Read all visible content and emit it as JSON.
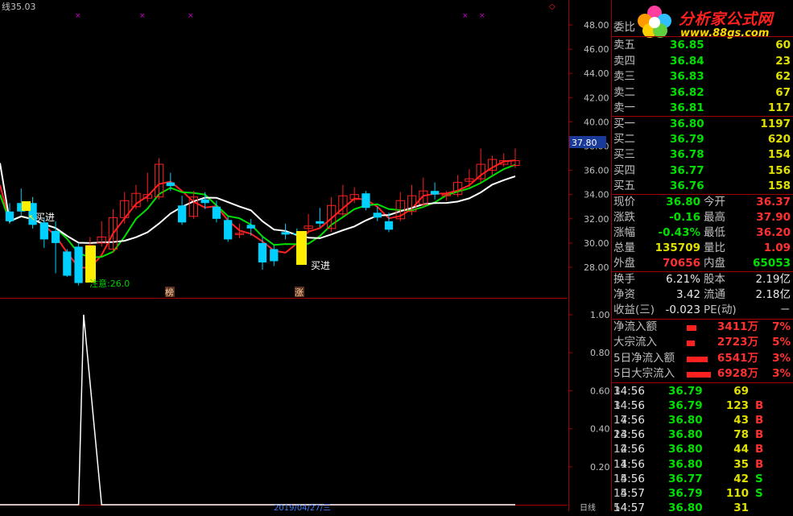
{
  "chart": {
    "title_prefix": "线",
    "title_value": "35.03",
    "y_ticks_main": [
      "48.00",
      "46.00",
      "44.00",
      "42.00",
      "40.00",
      "38.00",
      "36.00",
      "34.00",
      "32.00",
      "30.00",
      "28.00"
    ],
    "y_ticks_sub": [
      "1.00",
      "0.80",
      "0.60",
      "0.40",
      "0.20"
    ],
    "current_price_tag": "37.80",
    "annotations": {
      "buy1": "买进",
      "buy2": "买进",
      "notice": "注意:26.0",
      "badge_bang": "榜",
      "badge_zhang": "涨"
    },
    "bottom_date": "2019/04/27/三",
    "bottom_right": "日线",
    "colors": {
      "up": "#ff2020",
      "down": "#00d0ff",
      "ma_fast": "#ff2020",
      "ma_mid": "#00e000",
      "ma_slow": "#ffffff"
    }
  },
  "chart_data": {
    "type": "candlestick",
    "ylim": [
      27,
      49
    ],
    "candles": [
      {
        "o": 32.6,
        "c": 31.8,
        "h": 33.3,
        "l": 31.6
      },
      {
        "o": 33.3,
        "c": 32.6,
        "h": 34.5,
        "l": 32.3
      },
      {
        "o": 33.3,
        "c": 31.5,
        "h": 33.8,
        "l": 31.2
      },
      {
        "o": 31.7,
        "c": 30.3,
        "h": 32.1,
        "l": 29.6
      },
      {
        "o": 31.0,
        "c": 30.0,
        "h": 31.8,
        "l": 27.5
      },
      {
        "o": 29.3,
        "c": 27.3,
        "h": 29.5,
        "l": 27.2
      },
      {
        "o": 29.7,
        "c": 26.7,
        "h": 30.0,
        "l": 26.5
      },
      {
        "o": 29.2,
        "c": 29.8,
        "h": 30.5,
        "l": 28.7
      },
      {
        "o": 30.0,
        "c": 30.5,
        "h": 31.8,
        "l": 29.7
      },
      {
        "o": 29.5,
        "c": 32.1,
        "h": 32.8,
        "l": 29.2
      },
      {
        "o": 32.1,
        "c": 33.5,
        "h": 34.2,
        "l": 31.6
      },
      {
        "o": 33.0,
        "c": 34.1,
        "h": 34.8,
        "l": 32.8
      },
      {
        "o": 33.7,
        "c": 34.0,
        "h": 35.8,
        "l": 33.4
      },
      {
        "o": 33.8,
        "c": 36.5,
        "h": 37.0,
        "l": 33.6
      },
      {
        "o": 35.0,
        "c": 34.7,
        "h": 35.8,
        "l": 34.3
      },
      {
        "o": 33.1,
        "c": 31.7,
        "h": 33.9,
        "l": 31.5
      },
      {
        "o": 32.2,
        "c": 33.8,
        "h": 34.3,
        "l": 32.0
      },
      {
        "o": 33.6,
        "c": 33.3,
        "h": 34.2,
        "l": 32.8
      },
      {
        "o": 33.0,
        "c": 32.0,
        "h": 33.5,
        "l": 31.7
      },
      {
        "o": 31.9,
        "c": 30.3,
        "h": 32.2,
        "l": 30.1
      },
      {
        "o": 30.7,
        "c": 30.8,
        "h": 31.6,
        "l": 30.4
      },
      {
        "o": 31.5,
        "c": 31.2,
        "h": 32.0,
        "l": 30.6
      },
      {
        "o": 30.0,
        "c": 28.4,
        "h": 30.5,
        "l": 27.8
      },
      {
        "o": 29.5,
        "c": 28.5,
        "h": 29.8,
        "l": 28.1
      },
      {
        "o": 30.9,
        "c": 30.7,
        "h": 31.6,
        "l": 30.3
      },
      {
        "o": 30.8,
        "c": 30.7,
        "h": 31.2,
        "l": 30.4
      },
      {
        "o": 31.2,
        "c": 31.4,
        "h": 32.4,
        "l": 30.9
      },
      {
        "o": 31.8,
        "c": 31.6,
        "h": 32.9,
        "l": 31.3
      },
      {
        "o": 31.2,
        "c": 33.1,
        "h": 33.8,
        "l": 30.9
      },
      {
        "o": 32.4,
        "c": 33.9,
        "h": 34.8,
        "l": 32.2
      },
      {
        "o": 33.6,
        "c": 34.0,
        "h": 34.6,
        "l": 33.3
      },
      {
        "o": 34.1,
        "c": 32.9,
        "h": 34.3,
        "l": 32.7
      },
      {
        "o": 32.5,
        "c": 32.1,
        "h": 33.0,
        "l": 31.8
      },
      {
        "o": 31.8,
        "c": 31.1,
        "h": 32.5,
        "l": 30.9
      },
      {
        "o": 32.0,
        "c": 33.5,
        "h": 34.2,
        "l": 31.8
      },
      {
        "o": 32.6,
        "c": 33.9,
        "h": 34.8,
        "l": 32.3
      },
      {
        "o": 33.2,
        "c": 34.3,
        "h": 35.4,
        "l": 33.0
      },
      {
        "o": 34.3,
        "c": 34.0,
        "h": 35.0,
        "l": 33.6
      },
      {
        "o": 33.9,
        "c": 34.0,
        "h": 34.3,
        "l": 33.5
      },
      {
        "o": 34.0,
        "c": 35.0,
        "h": 35.6,
        "l": 33.8
      },
      {
        "o": 35.1,
        "c": 35.3,
        "h": 36.1,
        "l": 34.6
      },
      {
        "o": 35.3,
        "c": 36.5,
        "h": 37.8,
        "l": 35.0
      },
      {
        "o": 36.0,
        "c": 36.9,
        "h": 37.2,
        "l": 35.6
      },
      {
        "o": 36.5,
        "c": 36.8,
        "h": 37.4,
        "l": 36.3
      },
      {
        "o": 36.4,
        "c": 36.8,
        "h": 37.8,
        "l": 36.2
      }
    ],
    "sub_indicator": {
      "type": "line",
      "ylim": [
        0,
        1
      ],
      "values": [
        0,
        0,
        0,
        0,
        0,
        0,
        0,
        1,
        0,
        0,
        0,
        0,
        0,
        0,
        0,
        0,
        0,
        0,
        0,
        0,
        0,
        0,
        0,
        0,
        0,
        0,
        0,
        0,
        0,
        0,
        0,
        0,
        0,
        0,
        0,
        0,
        0,
        0,
        0,
        0,
        0,
        0,
        0,
        0,
        0
      ]
    }
  },
  "panel": {
    "wei_bi_label": "委比",
    "wei_bi_value": "",
    "sells": [
      {
        "label": "卖五",
        "price": "36.85",
        "vol": "60"
      },
      {
        "label": "卖四",
        "price": "36.84",
        "vol": "23"
      },
      {
        "label": "卖三",
        "price": "36.83",
        "vol": "62"
      },
      {
        "label": "卖二",
        "price": "36.82",
        "vol": "67"
      },
      {
        "label": "卖一",
        "price": "36.81",
        "vol": "117"
      }
    ],
    "buys": [
      {
        "label": "买一",
        "price": "36.80",
        "vol": "1197"
      },
      {
        "label": "买二",
        "price": "36.79",
        "vol": "620"
      },
      {
        "label": "买三",
        "price": "36.78",
        "vol": "154"
      },
      {
        "label": "买四",
        "price": "36.77",
        "vol": "156"
      },
      {
        "label": "买五",
        "price": "36.76",
        "vol": "158"
      }
    ],
    "stats": [
      {
        "l1": "现价",
        "v1": "36.80",
        "l2": "今开",
        "v2": "36.37"
      },
      {
        "l1": "涨跌",
        "v1": "-0.16",
        "l2": "最高",
        "v2": "37.90"
      },
      {
        "l1": "涨幅",
        "v1": "-0.43%",
        "l2": "最低",
        "v2": "36.20"
      },
      {
        "l1": "总量",
        "v1": "135709",
        "l2": "量比",
        "v2": "1.09"
      },
      {
        "l1": "外盘",
        "v1": "70656",
        "l2": "内盘",
        "v2": "65053"
      }
    ],
    "fin": [
      {
        "l1": "换手",
        "v1": "6.21%",
        "l2": "股本",
        "v2": "2.19亿"
      },
      {
        "l1": "净资",
        "v1": "3.42",
        "l2": "流通",
        "v2": "2.18亿"
      },
      {
        "l1": "收益(三)",
        "v1": "-0.023",
        "l2": "PE(动)",
        "v2": "－"
      }
    ],
    "flows": [
      {
        "label": "净流入额",
        "amount": "3411万",
        "pct": "7%",
        "bar": 0.25
      },
      {
        "label": "大宗流入",
        "amount": "2723万",
        "pct": "5%",
        "bar": 0.2
      },
      {
        "label": "5日净流入额",
        "amount": "6541万",
        "pct": "3%",
        "bar": 0.55
      },
      {
        "label": "5日大宗流入",
        "amount": "6928万",
        "pct": "3%",
        "bar": 0.62
      }
    ],
    "ticks": [
      {
        "time": "14:56",
        "price": "36.79",
        "vol": "69",
        "side": "",
        "n": "3"
      },
      {
        "time": "14:56",
        "price": "36.79",
        "vol": "123",
        "side": "B",
        "n": "34"
      },
      {
        "time": "14:56",
        "price": "36.80",
        "vol": "43",
        "side": "B",
        "n": "17"
      },
      {
        "time": "14:56",
        "price": "36.80",
        "vol": "78",
        "side": "B",
        "n": "23"
      },
      {
        "time": "14:56",
        "price": "36.80",
        "vol": "44",
        "side": "B",
        "n": "12"
      },
      {
        "time": "14:56",
        "price": "36.80",
        "vol": "35",
        "side": "B",
        "n": "11"
      },
      {
        "time": "14:56",
        "price": "36.77",
        "vol": "42",
        "side": "S",
        "n": "15"
      },
      {
        "time": "14:57",
        "price": "36.79",
        "vol": "110",
        "side": "S",
        "n": "15"
      },
      {
        "time": "14:57",
        "price": "36.80",
        "vol": "31",
        "side": "",
        "n": "5"
      }
    ]
  },
  "logo": {
    "text": "分析家公式网",
    "url": "www.88gs.com"
  }
}
